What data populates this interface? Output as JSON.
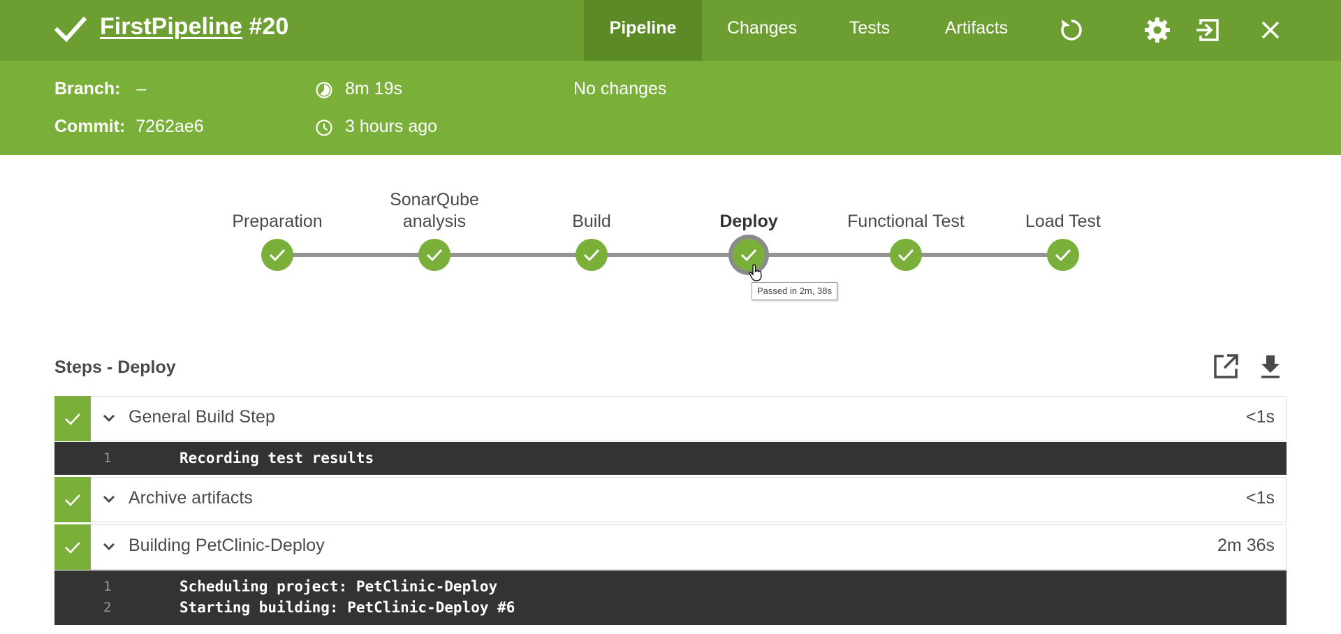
{
  "header": {
    "pipeline_name": "FirstPipeline",
    "run_number": "#20",
    "tabs": [
      {
        "label": "Pipeline",
        "active": true
      },
      {
        "label": "Changes",
        "active": false
      },
      {
        "label": "Tests",
        "active": false
      },
      {
        "label": "Artifacts",
        "active": false
      }
    ],
    "icons": [
      "replay-icon",
      "gear-icon",
      "exit-icon",
      "close-icon"
    ],
    "colors": {
      "header": "#6c9e32",
      "active_tab": "#5b8a26",
      "info_bar": "#7ab03a",
      "success": "#7ab03a"
    }
  },
  "info": {
    "branch_label": "Branch:",
    "branch_value": "–",
    "commit_label": "Commit:",
    "commit_value": "7262ae6",
    "duration": "8m 19s",
    "started": "3 hours ago",
    "changes": "No changes"
  },
  "stages": [
    {
      "label": "Preparation",
      "status": "success"
    },
    {
      "label": "SonarQube analysis",
      "status": "success"
    },
    {
      "label": "Build",
      "status": "success"
    },
    {
      "label": "Deploy",
      "status": "success",
      "selected": true
    },
    {
      "label": "Functional Test",
      "status": "success"
    },
    {
      "label": "Load Test",
      "status": "success"
    }
  ],
  "tooltip": "Passed in 2m, 38s",
  "steps_title": "Steps - Deploy",
  "steps": [
    {
      "name": "General Build Step",
      "duration": "<1s",
      "log": [
        {
          "n": "1",
          "text": "Recording test results"
        }
      ]
    },
    {
      "name": "Archive artifacts",
      "duration": "<1s",
      "log": []
    },
    {
      "name": "Building PetClinic-Deploy",
      "duration": "2m 36s",
      "log": [
        {
          "n": "1",
          "text": "Scheduling project: PetClinic-Deploy"
        },
        {
          "n": "2",
          "text": "Starting building: PetClinic-Deploy #6"
        }
      ]
    }
  ]
}
